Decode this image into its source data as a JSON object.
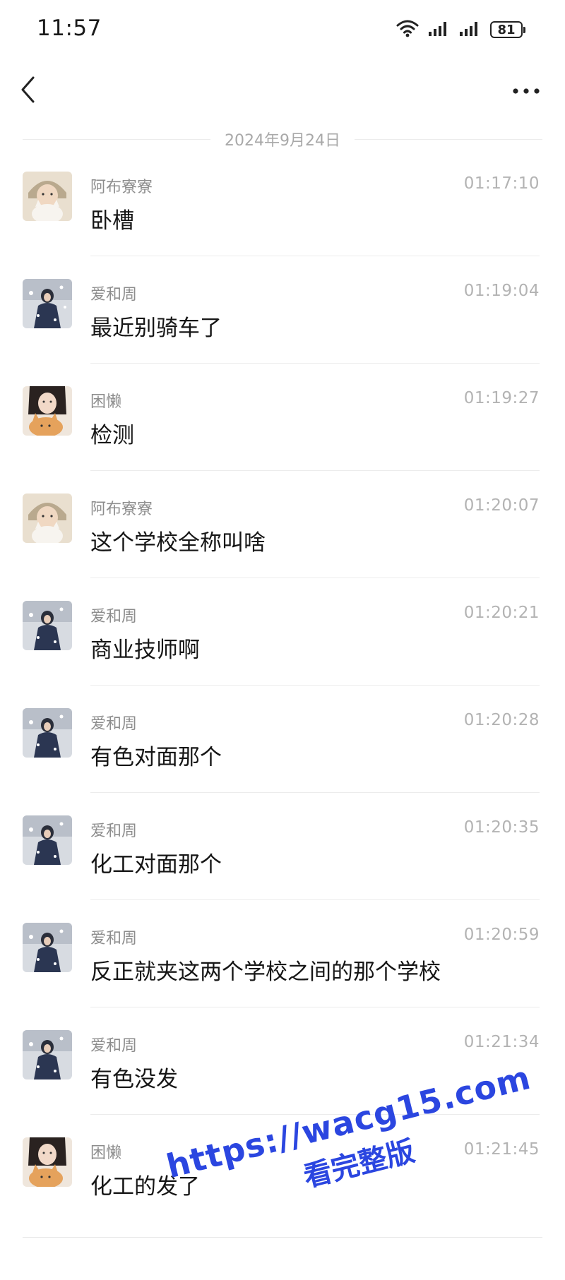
{
  "status_bar": {
    "time": "11:57",
    "battery": "81",
    "icons": [
      "wifi-icon",
      "signal-icon",
      "signal-icon",
      "battery-icon"
    ]
  },
  "nav": {
    "back_icon": "chevron-left-icon",
    "more_icon": "more-horizontal-icon"
  },
  "date_divider": "2024年9月24日",
  "messages": [
    {
      "name": "阿布寮寮",
      "time": "01:17:10",
      "text": "卧槽",
      "avatar": "cat-girl"
    },
    {
      "name": "爱和周",
      "time": "01:19:04",
      "text": "最近别骑车了",
      "avatar": "snow-girl"
    },
    {
      "name": "困懒",
      "time": "01:19:27",
      "text": "检测",
      "avatar": "orange-cat-girl"
    },
    {
      "name": "阿布寮寮",
      "time": "01:20:07",
      "text": "这个学校全称叫啥",
      "avatar": "cat-girl"
    },
    {
      "name": "爱和周",
      "time": "01:20:21",
      "text": "商业技师啊",
      "avatar": "snow-girl"
    },
    {
      "name": "爱和周",
      "time": "01:20:28",
      "text": "有色对面那个",
      "avatar": "snow-girl"
    },
    {
      "name": "爱和周",
      "time": "01:20:35",
      "text": "化工对面那个",
      "avatar": "snow-girl"
    },
    {
      "name": "爱和周",
      "time": "01:20:59",
      "text": "反正就夹这两个学校之间的那个学校",
      "avatar": "snow-girl"
    },
    {
      "name": "爱和周",
      "time": "01:21:34",
      "text": "有色没发",
      "avatar": "snow-girl"
    },
    {
      "name": "困懒",
      "time": "01:21:45",
      "text": "化工的发了",
      "avatar": "orange-cat-girl"
    }
  ],
  "watermark": {
    "url": "https://wacg15.com",
    "text": "看完整版"
  },
  "colors": {
    "watermark": "#2b46e0",
    "name": "#8d8d8d",
    "time": "#b3b3b3"
  }
}
